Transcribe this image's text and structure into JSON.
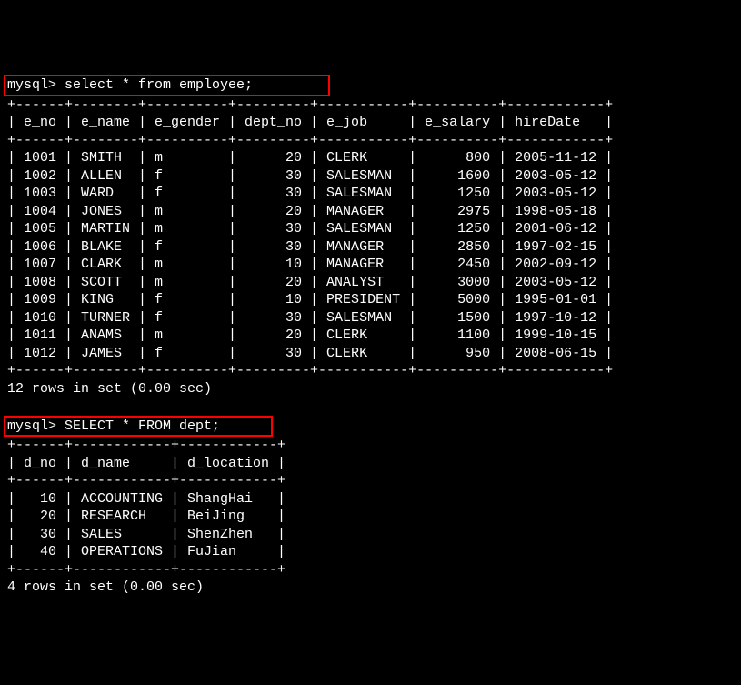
{
  "query1": {
    "prompt": "mysql>",
    "sql": "select * from employee;",
    "separator": "+------+--------+----------+---------+-----------+----------+------------+",
    "header": "| e_no | e_name | e_gender | dept_no | e_job     | e_salary | hireDate   |",
    "rows": [
      "| 1001 | SMITH  | m        |      20 | CLERK     |      800 | 2005-11-12 |",
      "| 1002 | ALLEN  | f        |      30 | SALESMAN  |     1600 | 2003-05-12 |",
      "| 1003 | WARD   | f        |      30 | SALESMAN  |     1250 | 2003-05-12 |",
      "| 1004 | JONES  | m        |      20 | MANAGER   |     2975 | 1998-05-18 |",
      "| 1005 | MARTIN | m        |      30 | SALESMAN  |     1250 | 2001-06-12 |",
      "| 1006 | BLAKE  | f        |      30 | MANAGER   |     2850 | 1997-02-15 |",
      "| 1007 | CLARK  | m        |      10 | MANAGER   |     2450 | 2002-09-12 |",
      "| 1008 | SCOTT  | m        |      20 | ANALYST   |     3000 | 2003-05-12 |",
      "| 1009 | KING   | f        |      10 | PRESIDENT |     5000 | 1995-01-01 |",
      "| 1010 | TURNER | f        |      30 | SALESMAN  |     1500 | 1997-10-12 |",
      "| 1011 | ANAMS  | m        |      20 | CLERK     |     1100 | 1999-10-15 |",
      "| 1012 | JAMES  | f        |      30 | CLERK     |      950 | 2008-06-15 |"
    ],
    "footer": "12 rows in set (0.00 sec)"
  },
  "query2": {
    "prompt": "mysql>",
    "sql": "SELECT * FROM dept;",
    "separator": "+------+------------+------------+",
    "header": "| d_no | d_name     | d_location |",
    "rows": [
      "|   10 | ACCOUNTING | ShangHai   |",
      "|   20 | RESEARCH   | BeiJing    |",
      "|   30 | SALES      | ShenZhen   |",
      "|   40 | OPERATIONS | FuJian     |"
    ],
    "footer": "4 rows in set (0.00 sec)"
  },
  "chart_data": [
    {
      "type": "table",
      "title": "employee",
      "columns": [
        "e_no",
        "e_name",
        "e_gender",
        "dept_no",
        "e_job",
        "e_salary",
        "hireDate"
      ],
      "rows": [
        [
          1001,
          "SMITH",
          "m",
          20,
          "CLERK",
          800,
          "2005-11-12"
        ],
        [
          1002,
          "ALLEN",
          "f",
          30,
          "SALESMAN",
          1600,
          "2003-05-12"
        ],
        [
          1003,
          "WARD",
          "f",
          30,
          "SALESMAN",
          1250,
          "2003-05-12"
        ],
        [
          1004,
          "JONES",
          "m",
          20,
          "MANAGER",
          2975,
          "1998-05-18"
        ],
        [
          1005,
          "MARTIN",
          "m",
          30,
          "SALESMAN",
          1250,
          "2001-06-12"
        ],
        [
          1006,
          "BLAKE",
          "f",
          30,
          "MANAGER",
          2850,
          "1997-02-15"
        ],
        [
          1007,
          "CLARK",
          "m",
          10,
          "MANAGER",
          2450,
          "2002-09-12"
        ],
        [
          1008,
          "SCOTT",
          "m",
          20,
          "ANALYST",
          3000,
          "2003-05-12"
        ],
        [
          1009,
          "KING",
          "f",
          10,
          "PRESIDENT",
          5000,
          "1995-01-01"
        ],
        [
          1010,
          "TURNER",
          "f",
          30,
          "SALESMAN",
          1500,
          "1997-10-12"
        ],
        [
          1011,
          "ANAMS",
          "m",
          20,
          "CLERK",
          1100,
          "1999-10-15"
        ],
        [
          1012,
          "JAMES",
          "f",
          30,
          "CLERK",
          950,
          "2008-06-15"
        ]
      ]
    },
    {
      "type": "table",
      "title": "dept",
      "columns": [
        "d_no",
        "d_name",
        "d_location"
      ],
      "rows": [
        [
          10,
          "ACCOUNTING",
          "ShangHai"
        ],
        [
          20,
          "RESEARCH",
          "BeiJing"
        ],
        [
          30,
          "SALES",
          "ShenZhen"
        ],
        [
          40,
          "OPERATIONS",
          "FuJian"
        ]
      ]
    }
  ]
}
